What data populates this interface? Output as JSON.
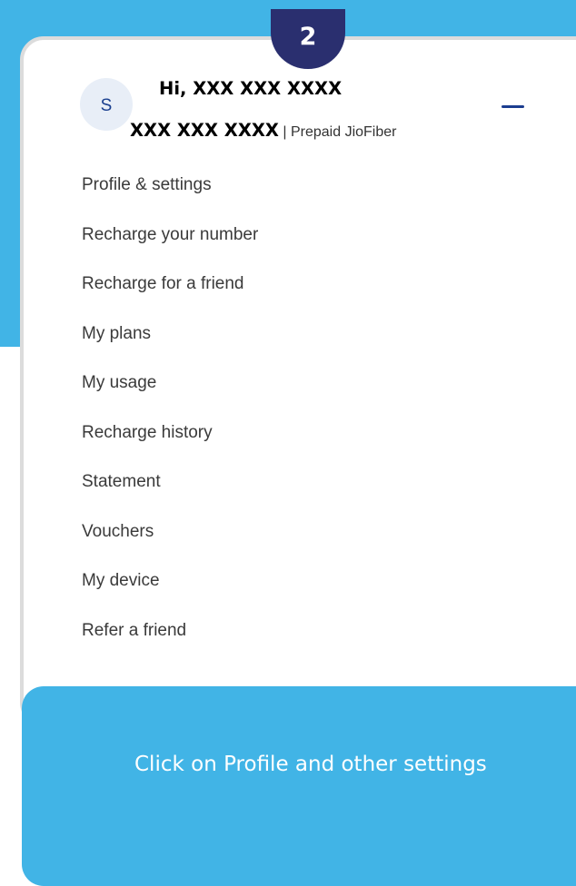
{
  "colors": {
    "accent": "#41b4e6",
    "badge": "#2a2f6f",
    "avatar_text": "#1a3f8f",
    "collapse": "#1b3d8f"
  },
  "step": {
    "number": "2"
  },
  "profile": {
    "avatar_initial": "S",
    "greeting": "Hi,  XXX XXX XXXX",
    "account_number": "XXX XXX XXXX",
    "account_type": " | Prepaid JioFiber",
    "collapse_icon": "minus-icon"
  },
  "menu": {
    "items": [
      {
        "label": "Profile & settings"
      },
      {
        "label": "Recharge your number"
      },
      {
        "label": "Recharge for a friend"
      },
      {
        "label": "My plans"
      },
      {
        "label": "My usage"
      },
      {
        "label": "Recharge history"
      },
      {
        "label": "Statement"
      },
      {
        "label": "Vouchers"
      },
      {
        "label": "My device"
      },
      {
        "label": "Refer a friend"
      }
    ]
  },
  "callout": {
    "text": "Click on Profile and other settings"
  }
}
